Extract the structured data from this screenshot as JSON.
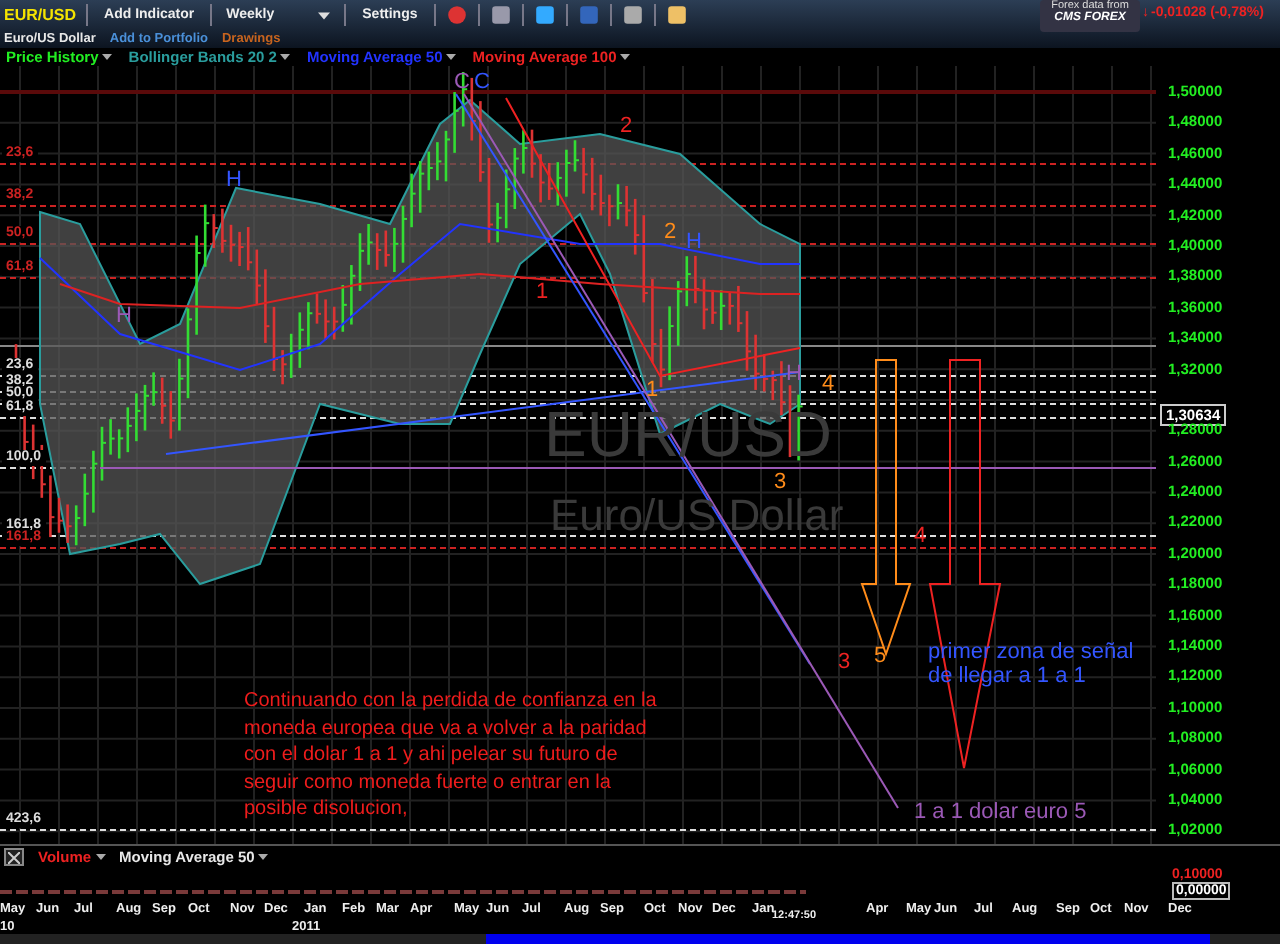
{
  "toolbar": {
    "symbol": "EUR/USD",
    "add_indicator": "Add Indicator",
    "interval": "Weekly",
    "settings": "Settings",
    "data_source": "Forex data from",
    "provider": "CMS FOREX",
    "change_arrow": "↓",
    "change": "-0,01028 (-0,78%)"
  },
  "subbar": [
    {
      "label": "Euro/US Dollar",
      "color": "#e8e8e8"
    },
    {
      "label": "Add to Portfolio",
      "color": "#4a90d9"
    },
    {
      "label": "Drawings",
      "color": "#c8641e"
    }
  ],
  "indicators": [
    {
      "label": "Price History",
      "color": "#22ee22"
    },
    {
      "label": "Bollinger Bands 20 2",
      "color": "#2a9d9d"
    },
    {
      "label": "Moving Average 50",
      "color": "#2233ff"
    },
    {
      "label": "Moving Average 100",
      "color": "#ee2222"
    }
  ],
  "chart": {
    "watermark_symbol": "EUR/USD",
    "watermark_name": "Euro/US Dollar",
    "fib_levels": [
      {
        "label": "23,6",
        "color": "#cc2222"
      },
      {
        "label": "38,2",
        "color": "#cc2222"
      },
      {
        "label": "50,0",
        "color": "#cc2222"
      },
      {
        "label": "61,8",
        "color": "#cc2222"
      },
      {
        "label": "23,6",
        "color": "#dddddd"
      },
      {
        "label": "38,2",
        "color": "#dddddd"
      },
      {
        "label": "50,0",
        "color": "#dddddd"
      },
      {
        "label": "61,8",
        "color": "#dddddd"
      },
      {
        "label": "100,0",
        "color": "#dddddd"
      },
      {
        "label": "161,8",
        "color": "#dddddd"
      },
      {
        "label": "161,8",
        "color": "#cc2222"
      },
      {
        "label": "423,6",
        "color": "#dddddd"
      }
    ],
    "annotations": [
      {
        "text": "H",
        "color": "#9b59b6"
      },
      {
        "text": "H",
        "color": "#3355ff"
      },
      {
        "text": "C",
        "color": "#9b59b6"
      },
      {
        "text": "C",
        "color": "#3355ff"
      },
      {
        "text": "2",
        "color": "#ee2222"
      },
      {
        "text": "1",
        "color": "#ee2222"
      },
      {
        "text": "2",
        "color": "#ff8c1a"
      },
      {
        "text": "H",
        "color": "#3355ff"
      },
      {
        "text": "1",
        "color": "#ff8c1a"
      },
      {
        "text": "H",
        "color": "#9b59b6"
      },
      {
        "text": "4",
        "color": "#ff8c1a"
      },
      {
        "text": "3",
        "color": "#ff8c1a"
      },
      {
        "text": "4",
        "color": "#ee2222"
      },
      {
        "text": "3",
        "color": "#ee2222"
      },
      {
        "text": "5",
        "color": "#ff8c1a"
      },
      {
        "text": "primer zona de señal de llegar a 1 a 1",
        "color": "#3355ff"
      },
      {
        "text": "1 a 1 dolar euro 5",
        "color": "#9b59b6"
      }
    ],
    "note": "Continuando con la perdida de confianza en la moneda europea que va a volver a la paridad con el dolar 1 a 1 y ahi pelear su futuro de seguir como moneda fuerte o entrar en la posible disolucion,",
    "price_axis_upper": [
      "1,50000",
      "1,48000",
      "1,46000",
      "1,44000",
      "1,42000",
      "1,40000",
      "1,38000",
      "1,36000",
      "1,34000",
      "1,32000"
    ],
    "current_price": "1,30634",
    "price_axis_lower": [
      "1,28000",
      "1,26000",
      "1,24000",
      "1,22000",
      "1,20000",
      "1,18000",
      "1,16000",
      "1,14000",
      "1,12000",
      "1,10000",
      "1,08000",
      "1,06000",
      "1,04000",
      "1,02000"
    ]
  },
  "volume_pane": {
    "indicators": [
      {
        "label": "Volume",
        "color": "#ee2222"
      },
      {
        "label": "Moving Average 50",
        "color": "#e8e8e8"
      }
    ],
    "axis_max": "0,10000",
    "axis_current": "0,00000"
  },
  "time_axis": {
    "months": [
      "May",
      "Jun",
      "Jul",
      "Aug",
      "Sep",
      "Oct",
      "Nov",
      "Dec",
      "Jan",
      "Feb",
      "Mar",
      "Apr",
      "May",
      "Jun",
      "Jul",
      "Aug",
      "Sep",
      "Oct",
      "Nov",
      "Dec",
      "Jan",
      "12:47:50",
      "Apr",
      "May",
      "Jun",
      "Jul",
      "Aug",
      "Sep",
      "Oct",
      "Nov",
      "Dec"
    ],
    "years": [
      "10",
      "2011"
    ]
  }
}
